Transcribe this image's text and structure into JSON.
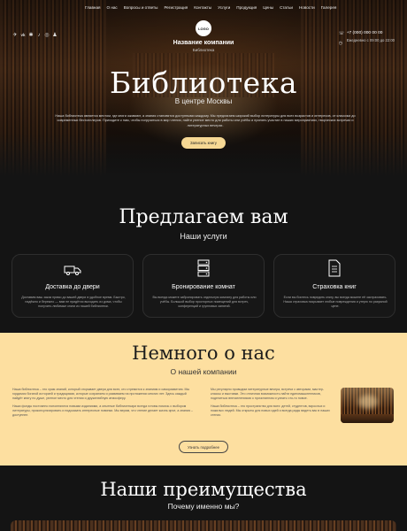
{
  "nav": {
    "items": [
      "Главная",
      "О нас",
      "Вопросы и ответы",
      "Регистрация",
      "Контакты",
      "Услуги",
      "Продукция",
      "Цены",
      "Статьи",
      "Новости",
      "Галерея"
    ]
  },
  "header": {
    "logo_text": "LOGO",
    "company_name": "Название компании",
    "company_sub": "Библиотека",
    "phone": "+7 (000) 000 00 00",
    "hours": "Ежедневно с 09:00 до 22:00",
    "socials": [
      "telegram-icon",
      "vk-icon",
      "odnoklassniki-icon",
      "twitter-icon",
      "whatsapp-icon",
      "snapchat-icon"
    ]
  },
  "hero": {
    "title": "Библиотека",
    "subtitle": "В центре Москвы",
    "text": "Наша библиотека является местом, где книги оживают, а знания становятся доступными каждому. Мы предлагаем широкий выбор литературы для всех возрастов и интересов, от классики до современных бестселлеров. Приходите к нам, чтобы погрузиться в мир чтения, найти уютное место для работы или учёбы и принять участие в наших мероприятиях, творческих встречах и литературных вечерах.",
    "button": "Записать книгу"
  },
  "services": {
    "title": "Предлагаем вам",
    "subtitle": "Наши услуги",
    "cards": [
      {
        "icon": "truck-icon",
        "title": "Доставка до двери",
        "text": "Доставим ваш заказ прямо до вашей двери в удобное время. Быстро, надёжно и бережно — вам не придётся выходить из дома, чтобы получить любимые книги из нашей библиотеки."
      },
      {
        "icon": "server-rack-icon",
        "title": "Бронирование комнат",
        "text": "Вы всегда можете забронировать отдельную комнату для работы или учёбы. Большой выбор просторных помещений для встреч, конференций и групповых занятий."
      },
      {
        "icon": "document-icon",
        "title": "Страховка книг",
        "text": "Если вы боитесь повредить книгу, вы всегда можете её застраховать. Наша страховка покрывает любые повреждения и утерю по разумной цене."
      }
    ]
  },
  "about": {
    "title": "Немного о нас",
    "subtitle": "О нашей компании",
    "left_col": [
      "Наша библиотека – это храм знаний, который открывает двери для всех, кто стремится к знаниям и саморазвитию. Мы гордимся богатой историей и традициями, которые сохраняем и развиваем на протяжении многих лет. Здесь каждый найдёт книгу по душе, уютное место для чтения и дружелюбную атмосферу.",
      "Наши фонды постоянно пополняются новыми изданиями, а опытные библиотекари всегда готовы помочь с выбором литературы, проконсультировать и подсказать интересные новинки. Мы верим, что чтение делает жизнь ярче, а знания – доступнее."
    ],
    "right_col": [
      "Мы регулярно проводим литературные вечера, встречи с авторами, мастер-классы и выставки. Это отличная возможность найти единомышленников, поделиться впечатлениями о прочитанном и узнать что-то новое.",
      "Наша библиотека – это пространство для всех: детей, студентов, взрослых и пожилых людей. Мы открыты для новых идей и всегда рады видеть вас в наших стенах."
    ],
    "button": "Узнать подробнее"
  },
  "advantages": {
    "title": "Наши преимущества",
    "subtitle": "Почему именно мы?"
  },
  "colors": {
    "accent": "#f6d894",
    "about_bg": "#fddfa0",
    "page_bg": "#141414"
  }
}
